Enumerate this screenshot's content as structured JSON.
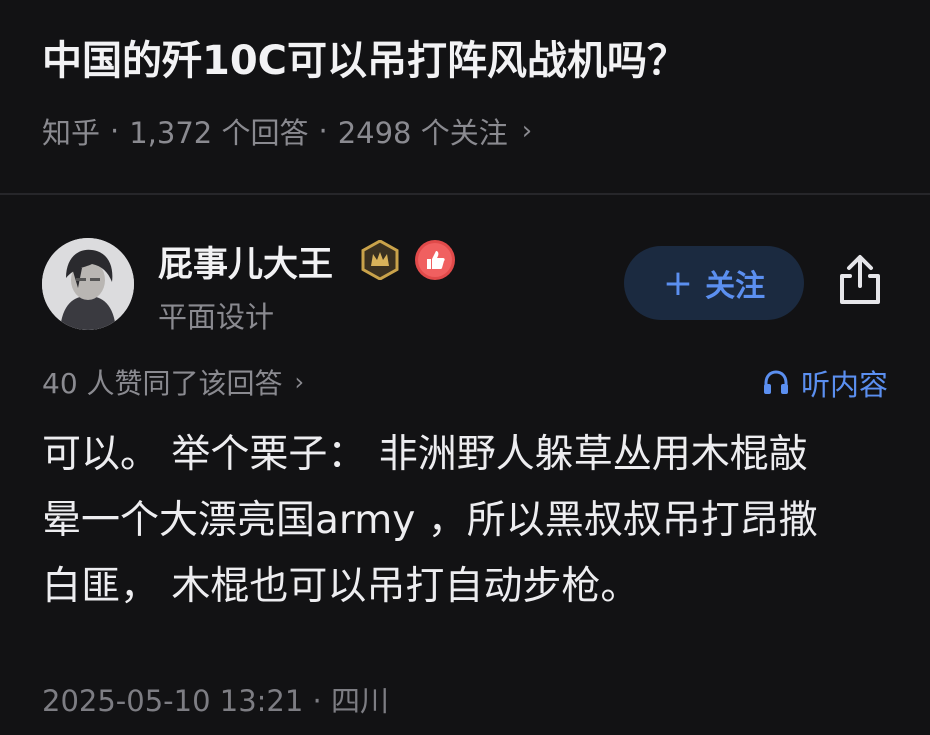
{
  "question": {
    "title": "中国的歼10C可以吊打阵风战机吗？",
    "source": "知乎",
    "answer_count": "1,372 个回答",
    "follower_count": "2498 个关注",
    "separator": "·",
    "chevron": "›"
  },
  "author": {
    "name": "屁事儿大王",
    "subtitle": "平面设计",
    "follow_label": "关注",
    "follow_plus": "+"
  },
  "answer": {
    "likes_text": "40 人赞同了该回答",
    "chevron": "›",
    "listen_label": "听内容",
    "content_lines": [
      "可以。 举个栗子： 非洲野人躲草丛用木棍敲",
      "晕一个大漂亮国army ，所以黑叔叔吊打昂撒",
      "白匪， 木棍也可以吊打自动步枪。"
    ],
    "footer": "2025-05-10 13:21 · 四川"
  },
  "colors": {
    "background": "#121214",
    "accent": "#5b8ff0",
    "muted": "#8a8a90",
    "badge_gold": "#c9a24a",
    "badge_red": "#e04a4a"
  }
}
